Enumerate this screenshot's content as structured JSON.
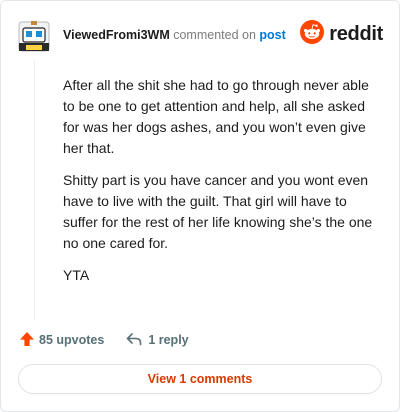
{
  "header": {
    "username": "ViewedFromi3WM",
    "action_text": "commented on",
    "post_link": "post",
    "brand_icon": "reddit-alien-icon",
    "brand_word": "reddit",
    "avatar_icon": "snoo-avatar-icon"
  },
  "comment": {
    "paragraphs": [
      "After all the shit she had to go through never able to be one to get attention and help, all she asked for was her dogs ashes, and you won’t even give her that.",
      "Shitty part is you have cancer and you wont even have to live with the guilt. That girl will have to suffer for the rest of her life knowing she’s the one no one cared for.",
      "YTA"
    ]
  },
  "actions": {
    "upvotes": "85 upvotes",
    "replies": "1 reply",
    "upvote_icon": "upvote-arrow-icon",
    "reply_icon": "reply-arrow-icon"
  },
  "footer": {
    "view_comments": "View 1 comments"
  },
  "colors": {
    "brand_orange": "#ff4500",
    "link_blue": "#0079d3",
    "view_button_text": "#d93a00",
    "meta_gray": "#576f76"
  }
}
